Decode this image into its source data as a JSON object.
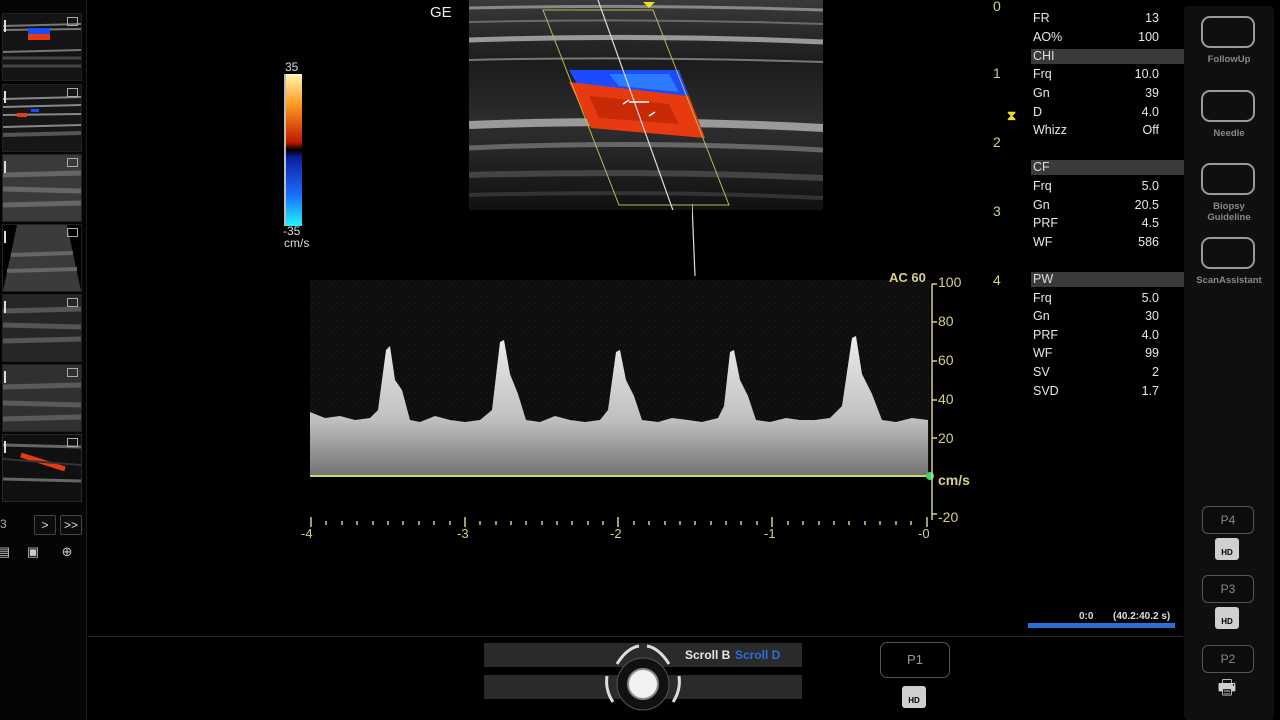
{
  "image_label": "GE",
  "color_scale": {
    "max": "35",
    "min": "-35",
    "unit": "cm/s"
  },
  "depth_scale": [
    "0",
    "1",
    "2",
    "3",
    "4"
  ],
  "doppler": {
    "ac_label": "AC 60",
    "y_ticks": [
      "100",
      "80",
      "60",
      "40",
      "20",
      "-20"
    ],
    "unit": "cm/s",
    "x_ticks": [
      "-4",
      "-3",
      "-2",
      "-1",
      "-0"
    ]
  },
  "thumbnails": {
    "page_fragment": "3",
    "next_label": ">",
    "last_label": ">>"
  },
  "params": {
    "top": [
      {
        "k": "FR",
        "v": "13"
      },
      {
        "k": "AO%",
        "v": "100"
      }
    ],
    "chi": {
      "title": "CHI",
      "rows": [
        {
          "k": "Frq",
          "v": "10.0"
        },
        {
          "k": "Gn",
          "v": "39"
        },
        {
          "k": "D",
          "v": "4.0"
        },
        {
          "k": "Whizz",
          "v": "Off"
        }
      ]
    },
    "cf": {
      "title": "CF",
      "rows": [
        {
          "k": "Frq",
          "v": "5.0"
        },
        {
          "k": "Gn",
          "v": "20.5"
        },
        {
          "k": "PRF",
          "v": "4.5"
        },
        {
          "k": "WF",
          "v": "586"
        }
      ]
    },
    "pw": {
      "title": "PW",
      "rows": [
        {
          "k": "Frq",
          "v": "5.0"
        },
        {
          "k": "Gn",
          "v": "30"
        },
        {
          "k": "PRF",
          "v": "4.0"
        },
        {
          "k": "WF",
          "v": "99"
        },
        {
          "k": "SV",
          "v": "2"
        },
        {
          "k": "SVD",
          "v": "1.7"
        }
      ]
    }
  },
  "cine": {
    "position": "0:0",
    "duration": "(40.2:40.2 s)"
  },
  "right_buttons": {
    "followup": "FollowUp",
    "needle": "Needle",
    "biopsy_1": "Biopsy",
    "biopsy_2": "Guideline",
    "scanassistant": "ScanAssistant",
    "p4": "P4",
    "p3": "P3",
    "p2": "P2"
  },
  "bottom": {
    "scroll_b": "Scroll B",
    "scroll_d": "Scroll D",
    "p1": "P1",
    "hd": "HD"
  },
  "colors": {
    "accent_yellow": "#d6cf8c",
    "baseline_green": "#c8d66a",
    "flow_red": "#e83a10",
    "flow_blue": "#1a4bff",
    "progress_blue": "#2a6fd6"
  }
}
